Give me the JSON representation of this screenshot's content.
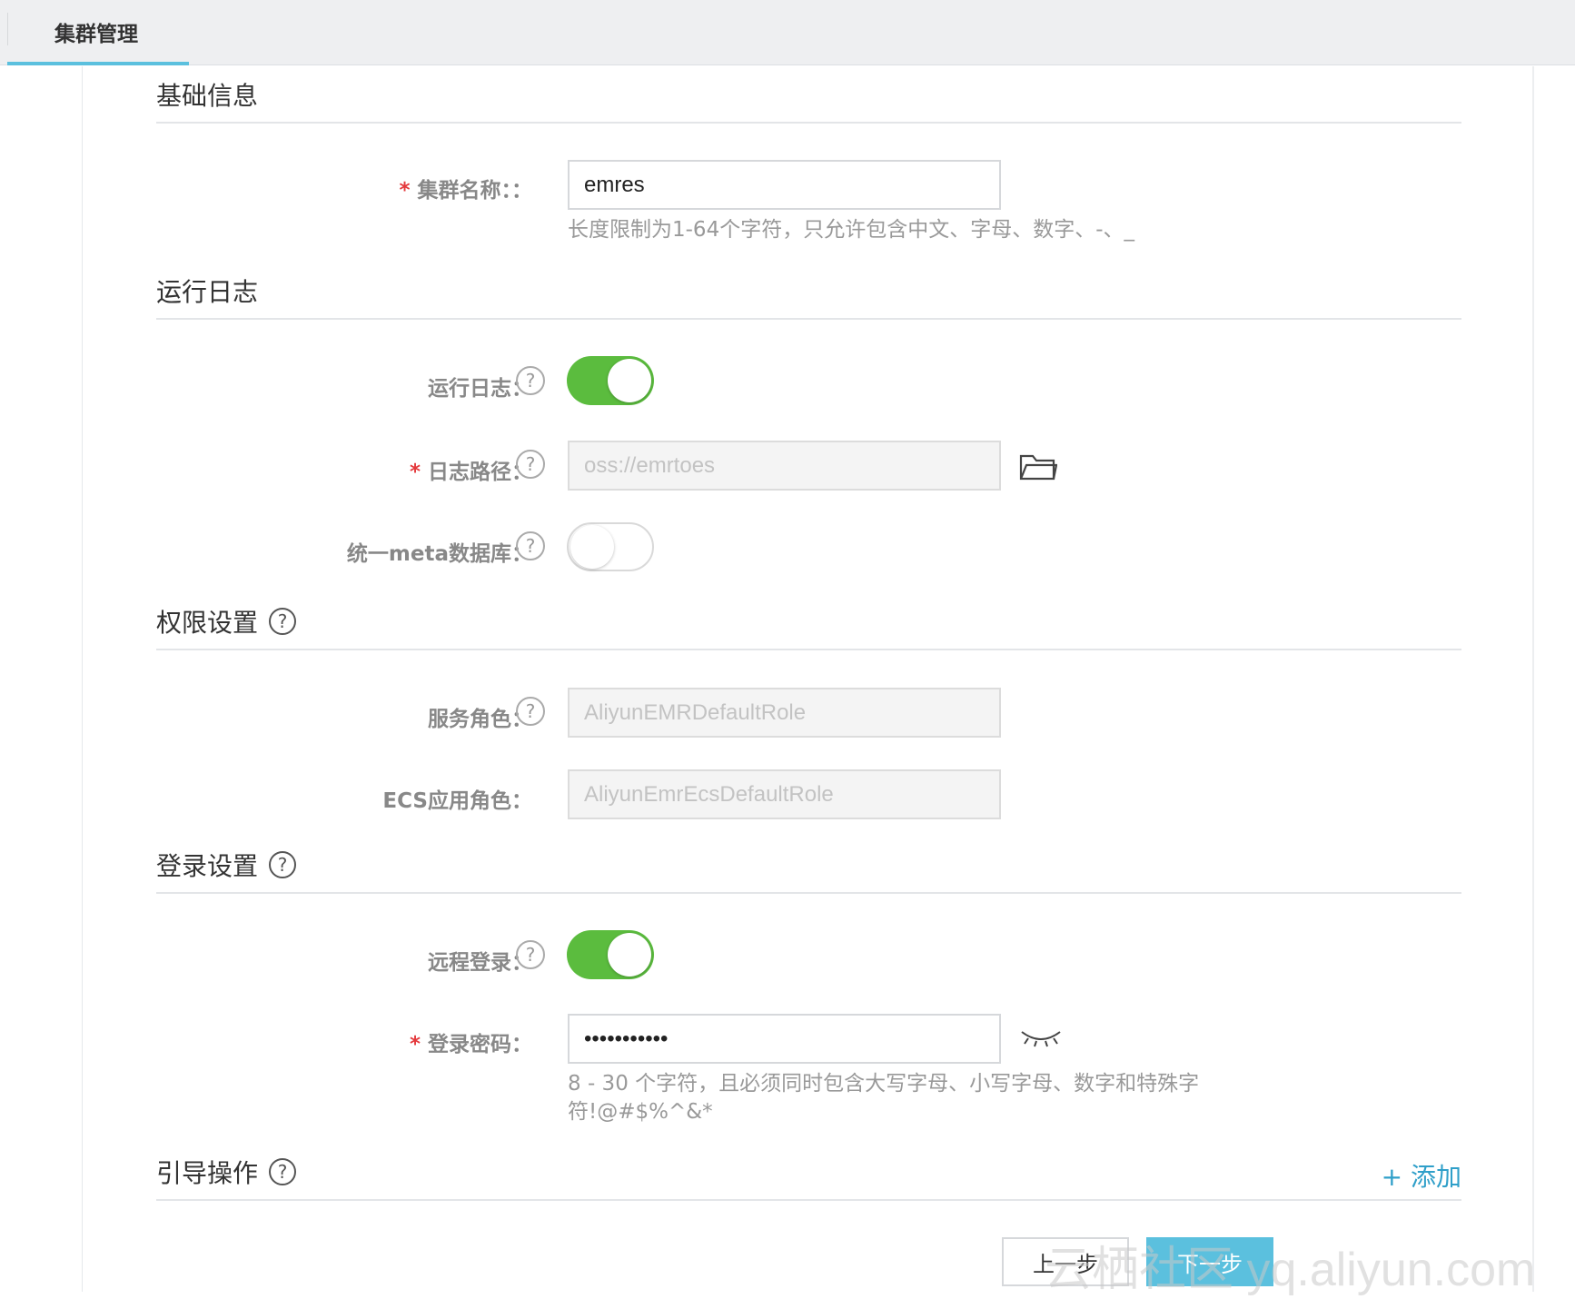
{
  "tabs": {
    "active_label": "集群管理"
  },
  "sections": {
    "basic": {
      "title": "基础信息"
    },
    "logs": {
      "title": "运行日志"
    },
    "permissions": {
      "title": "权限设置"
    },
    "login": {
      "title": "登录设置"
    },
    "bootstrap": {
      "title": "引导操作"
    }
  },
  "fields": {
    "cluster_name": {
      "label": "集群名称：：",
      "value": "emres",
      "hint": "长度限制为1-64个字符，只允许包含中文、字母、数字、-、_"
    },
    "run_log": {
      "label": "运行日志：",
      "enabled": true
    },
    "log_path": {
      "label": "日志路径：",
      "value": "oss://emrtoes"
    },
    "unified_meta": {
      "label": "统一meta数据库：",
      "enabled": false
    },
    "service_role": {
      "label": "服务角色：",
      "value": "AliyunEMRDefaultRole"
    },
    "ecs_role": {
      "label": "ECS应用角色：",
      "value": "AliyunEmrEcsDefaultRole"
    },
    "remote_login": {
      "label": "远程登录：",
      "enabled": true
    },
    "login_password": {
      "label": "登录密码：",
      "value": "•••••••••••",
      "hint_line1": "8 - 30 个字符，且必须同时包含大写字母、小写字母、数字和特殊字",
      "hint_line2": "符!@#$%^&*"
    }
  },
  "help_glyph": "?",
  "required_mark": "*",
  "actions": {
    "add_label": "+ 添加",
    "prev_label": "上一步",
    "next_label": "下一步"
  },
  "watermark": "云栖社区 yq.aliyun.com",
  "colors": {
    "accent": "#5bc0de",
    "switch_on": "#5bbc3e",
    "required": "#e4393c",
    "link": "#2f9fc9"
  },
  "icons": {
    "folder": "folder-open-icon",
    "eye": "eye-closed-icon",
    "help": "question-circle-icon"
  }
}
